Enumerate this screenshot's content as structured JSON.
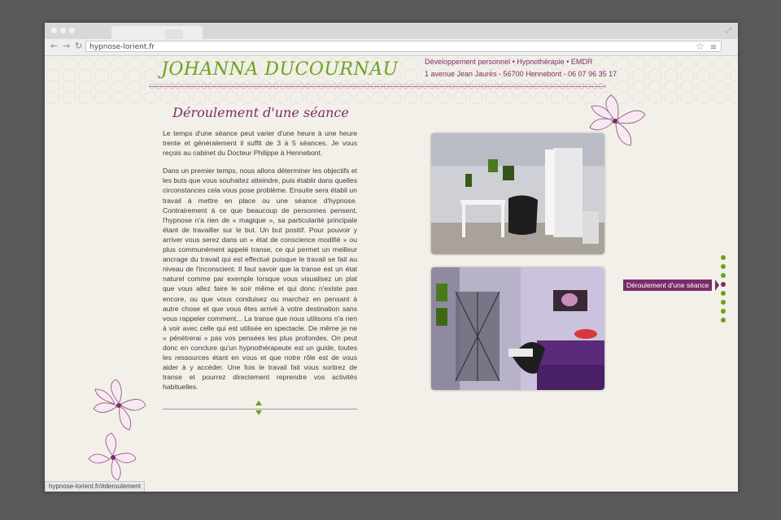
{
  "browser": {
    "url": "hypnose-lorient.fr",
    "status_url": "hypnose-lorient.fr/#deroulement"
  },
  "header": {
    "site_title": "JOHANNA DUCOURNAU",
    "tagline": "Développement personnel • Hypnothérapie • EMDR",
    "address": "1 avenue Jean Jaurès - 56700 Hennebont - 06 07 96 35 17"
  },
  "main": {
    "section_title": "Déroulement d'une séance",
    "paragraphs": [
      "Le temps d'une séance peut varier d'une heure à une heure trente et généralement il suffit de 3 à 5 séances. Je vous reçois au cabinet du Docteur Philippe à Hennebont.",
      "Dans un premier temps, nous allons déterminer les objectifs et les buts que vous souhaitez atteindre, puis établir dans quelles circonstances cela vous pose problème. Ensuite sera établi un travail à mettre en place ou une séance d'hypnose. Contrairement à ce que beaucoup de personnes pensent, l'hypnose n'a rien de « magique », sa particularité principale étant de travailler sur le but. Un but positif. Pour pouvoir y arriver vous serez dans un « état de conscience modifié » ou plus communément appelé transe, ce qui permet un meilleur ancrage du travail qui est effectué puisque le travail se fait au niveau de l'inconscient. Il faut savoir que la transe est un état naturel comme par exemple lorsque vous visualisez un plat que vous allez faire le soir même et qui donc n'existe pas encore, ou que vous conduisez ou marchez en pensant à autre chose et que vous êtes arrivé à votre destination sans vous rappeler comment... La transe que nous utilisons n'a rien à voir avec celle qui est utilisée en spectacle. De même je ne « pénétrerai » pas vos pensées les plus profondes. On peut donc en conclure qu'un hypnothérapeute est un guide, toutes les ressources étant en vous et que notre rôle est de vous aider à y accéder. Une fois le travail fait vous sortirez de transe et pourrez directement reprendre vos activités habituelles."
    ]
  },
  "side_nav": {
    "active_label": "Déroulement d'une séance",
    "dot_count": 8,
    "active_index": 3
  },
  "colors": {
    "accent_green": "#6aa31c",
    "accent_purple": "#7a2c6a",
    "background": "#f2f0e8"
  },
  "icons": [
    "back-arrow-icon",
    "forward-arrow-icon",
    "reload-icon",
    "star-icon",
    "menu-icon",
    "arrow-up-icon",
    "arrow-down-icon",
    "flower-icon"
  ]
}
